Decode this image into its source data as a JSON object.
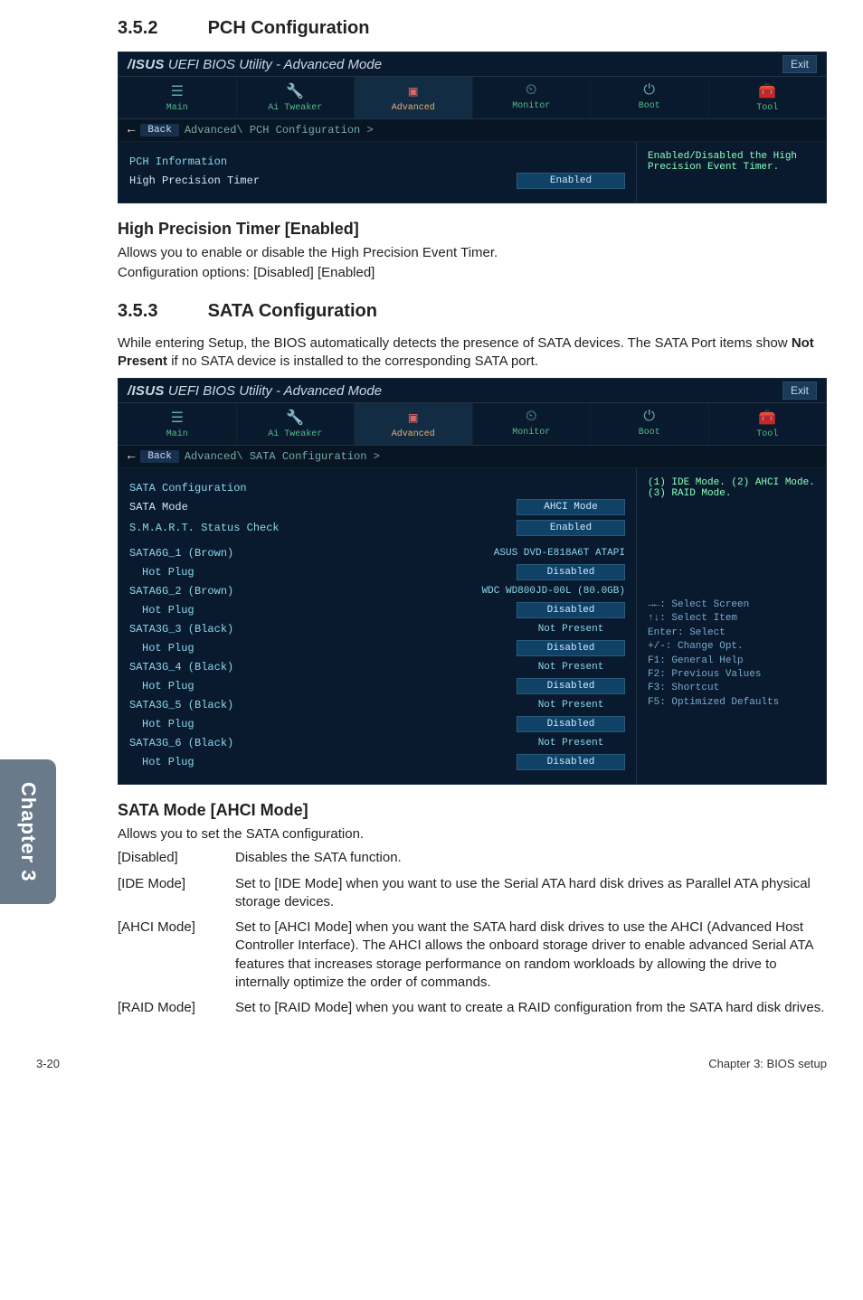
{
  "section_352": {
    "num": "3.5.2",
    "title": "PCH Configuration"
  },
  "section_353": {
    "num": "3.5.3",
    "title": "SATA Configuration"
  },
  "side_tab": "Chapter 3",
  "hp_timer": {
    "heading": "High Precision Timer [Enabled]",
    "desc1": "Allows you to enable or disable the High Precision Event Timer.",
    "desc2": "Configuration options: [Disabled] [Enabled]"
  },
  "sata_intro": "While entering Setup, the BIOS automatically detects the presence of SATA devices. The SATA Port items show ",
  "sata_intro_bold": "Not Present",
  "sata_intro_tail": " if no SATA device is installed to the corresponding SATA port.",
  "sata_mode_heading": "SATA Mode [AHCI Mode]",
  "sata_mode_desc": "Allows you to set the SATA configuration.",
  "defs": {
    "disabled": {
      "term": "[Disabled]",
      "text": "Disables the SATA function."
    },
    "ide": {
      "term": "[IDE Mode]",
      "text": "Set to [IDE Mode] when you want to use the Serial ATA hard disk drives as Parallel ATA physical storage devices."
    },
    "ahci": {
      "term": "[AHCI Mode]",
      "text": "Set to [AHCI Mode] when you want the SATA hard disk drives to use the AHCI (Advanced Host Controller Interface). The AHCI allows the onboard storage driver to enable advanced Serial ATA features that increases storage performance on random workloads by allowing the drive to internally optimize the order of commands."
    },
    "raid": {
      "term": "[RAID Mode]",
      "text": "Set to [RAID Mode] when you want to create a RAID configuration from the SATA hard disk drives."
    }
  },
  "footer": {
    "left": "3-20",
    "right": "Chapter 3: BIOS setup"
  },
  "bios_common": {
    "brand_text": "UEFI BIOS Utility - Advanced Mode",
    "brand_pre": "/ISUS",
    "exit": "Exit",
    "tabs": {
      "main": "Main",
      "tweaker": "Ai Tweaker",
      "advanced": "Advanced",
      "monitor": "Monitor",
      "boot": "Boot",
      "tool": "Tool"
    },
    "back": "Back"
  },
  "bios1": {
    "crumb": "Advanced\\ PCH Configuration >",
    "rows": {
      "pchinfo": "PCH Information",
      "hpt_label": "High Precision Timer",
      "hpt_val": "Enabled"
    },
    "help": "Enabled/Disabled the High Precision Event Timer."
  },
  "bios2": {
    "crumb": "Advanced\\ SATA Configuration >",
    "rows": {
      "satacfg": "SATA Configuration",
      "satamode_label": "SATA Mode",
      "satamode_val": "AHCI Mode",
      "smart_label": "S.M.A.R.T. Status Check",
      "smart_val": "Enabled",
      "p1_label": "SATA6G_1 (Brown)",
      "p1_sub": "Hot Plug",
      "p1_port": "ASUS DVD-E818A6T ATAPI",
      "p1_val": "Disabled",
      "p2_label": "SATA6G_2 (Brown)",
      "p2_port": "WDC WD800JD-00L (80.0GB)",
      "p2_val": "Disabled",
      "p3_label": "SATA3G_3 (Black)",
      "p3_port": "Not Present",
      "p3_val": "Disabled",
      "p4_label": "SATA3G_4 (Black)",
      "p4_port": "Not Present",
      "p4_val": "Disabled",
      "p5_label": "SATA3G_5 (Black)",
      "p5_port": "Not Present",
      "p5_val": "Disabled",
      "p6_label": "SATA3G_6 (Black)",
      "p6_port": "Not Present",
      "p6_val": "Disabled"
    },
    "help": "(1) IDE Mode. (2) AHCI Mode. (3) RAID Mode.",
    "hk1": "→←: Select Screen",
    "hk2": "↑↓: Select Item",
    "hk3": "Enter: Select",
    "hk4": "+/-: Change Opt.",
    "hk5": "F1: General Help",
    "hk6": "F2: Previous Values",
    "hk7": "F3: Shortcut",
    "hk8": "F5: Optimized Defaults"
  }
}
